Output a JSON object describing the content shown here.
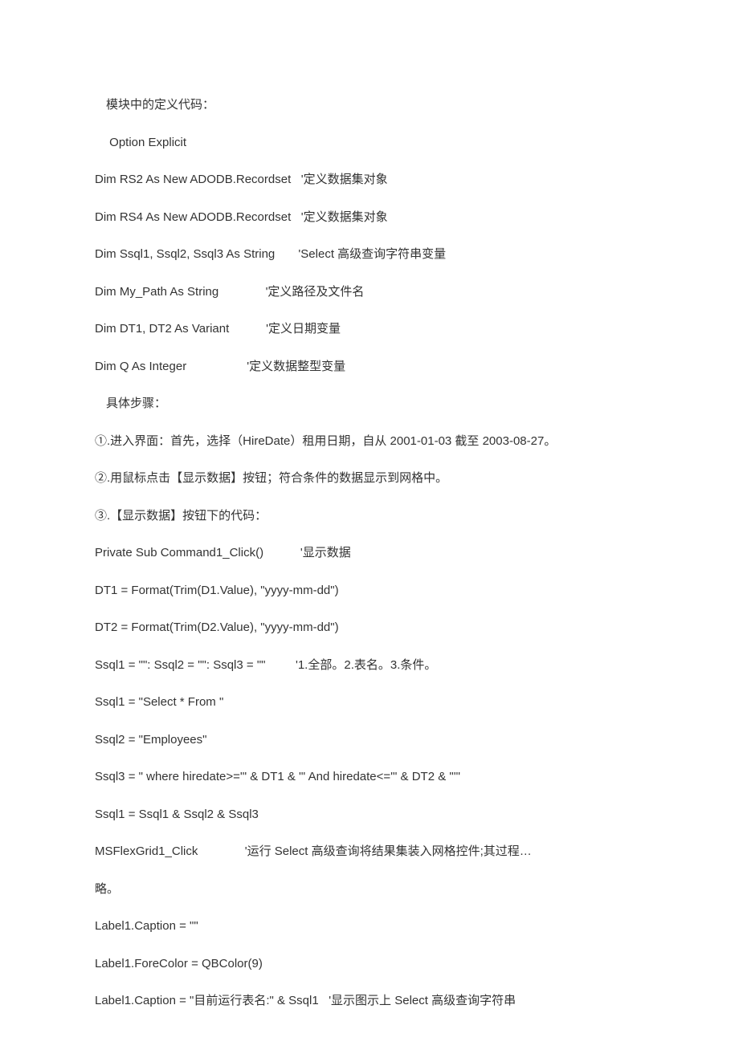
{
  "lines": [
    {
      "text": "模块中的定义代码：",
      "indent": true
    },
    {
      "text": " Option Explicit",
      "indent": true
    },
    {
      "text": "Dim RS2 As New ADODB.Recordset   '定义数据集对象",
      "indent": false
    },
    {
      "text": "Dim RS4 As New ADODB.Recordset   '定义数据集对象",
      "indent": false
    },
    {
      "text": "Dim Ssql1, Ssql2, Ssql3 As String       'Select 高级查询字符串变量",
      "indent": false
    },
    {
      "text": "Dim My_Path As String              '定义路径及文件名",
      "indent": false
    },
    {
      "text": "Dim DT1, DT2 As Variant           '定义日期变量",
      "indent": false
    },
    {
      "text": "Dim Q As Integer                  '定义数据整型变量",
      "indent": false
    },
    {
      "text": "具体步骤：",
      "indent": true
    },
    {
      "text": "①.进入界面：首先，选择（HireDate）租用日期，自从 2001-01-03 截至 2003-08-27。",
      "indent": false
    },
    {
      "text": "②.用鼠标点击【显示数据】按钮；符合条件的数据显示到网格中。",
      "indent": false
    },
    {
      "text": "③.【显示数据】按钮下的代码：",
      "indent": false
    },
    {
      "text": "Private Sub Command1_Click()           '显示数据",
      "indent": false
    },
    {
      "text": "DT1 = Format(Trim(D1.Value), \"yyyy-mm-dd\")",
      "indent": false
    },
    {
      "text": "DT2 = Format(Trim(D2.Value), \"yyyy-mm-dd\")",
      "indent": false
    },
    {
      "text": "Ssql1 = \"\": Ssql2 = \"\": Ssql3 = \"\"         '1.全部。2.表名。3.条件。",
      "indent": false
    },
    {
      "text": "Ssql1 = \"Select * From \"",
      "indent": false
    },
    {
      "text": "Ssql2 = \"Employees\"",
      "indent": false
    },
    {
      "text": "Ssql3 = \" where hiredate>='\" & DT1 & \"' And hiredate<='\" & DT2 & \"'\"",
      "indent": false
    },
    {
      "text": "Ssql1 = Ssql1 & Ssql2 & Ssql3",
      "indent": false
    },
    {
      "text": "MSFlexGrid1_Click              '运行 Select 高级查询将结果集装入网格控件;其过程…",
      "indent": false
    },
    {
      "text": "略。",
      "indent": false
    },
    {
      "text": "Label1.Caption = \"\"",
      "indent": false
    },
    {
      "text": "Label1.ForeColor = QBColor(9)",
      "indent": false
    },
    {
      "text": "Label1.Caption = \"目前运行表名:\" & Ssql1   '显示图示上 Select 高级查询字符串",
      "indent": false
    }
  ]
}
